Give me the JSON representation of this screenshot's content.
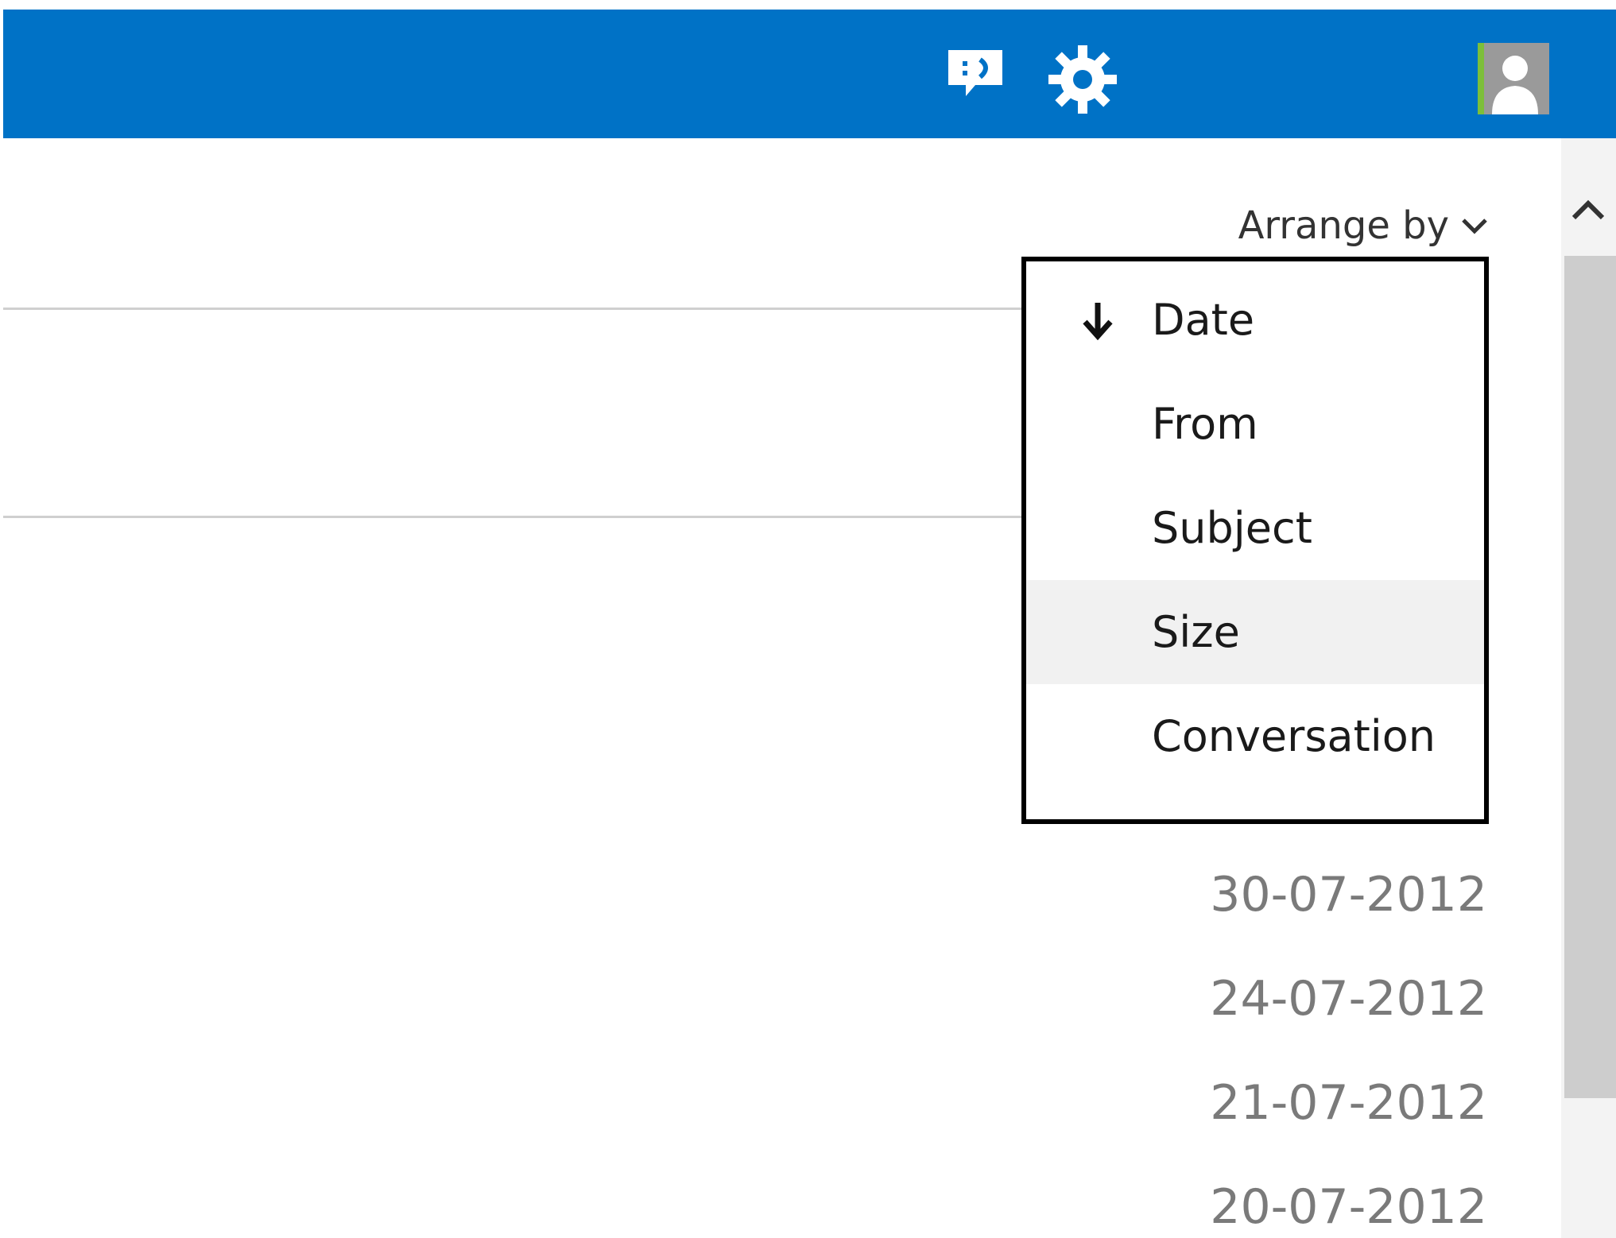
{
  "topbar": {
    "icons": {
      "feedback": "feedback-smiley-icon",
      "settings": "gear-icon",
      "avatar": "user-avatar-icon"
    },
    "color": "#0072C6"
  },
  "arrange_by": {
    "label": "Arrange by",
    "icon": "chevron-down-icon"
  },
  "menu": {
    "items": [
      {
        "label": "Date",
        "selected": true,
        "sort_icon": "arrow-down-icon"
      },
      {
        "label": "From",
        "selected": false
      },
      {
        "label": "Subject",
        "selected": false
      },
      {
        "label": "Size",
        "selected": false,
        "hovered": true
      },
      {
        "label": "Conversation",
        "selected": false
      }
    ],
    "highlight_color": "#f1f1f1"
  },
  "dates": [
    "30-07-2012",
    "24-07-2012",
    "21-07-2012",
    "20-07-2012"
  ],
  "scrollbar": {
    "up_icon": "chevron-up-icon"
  }
}
